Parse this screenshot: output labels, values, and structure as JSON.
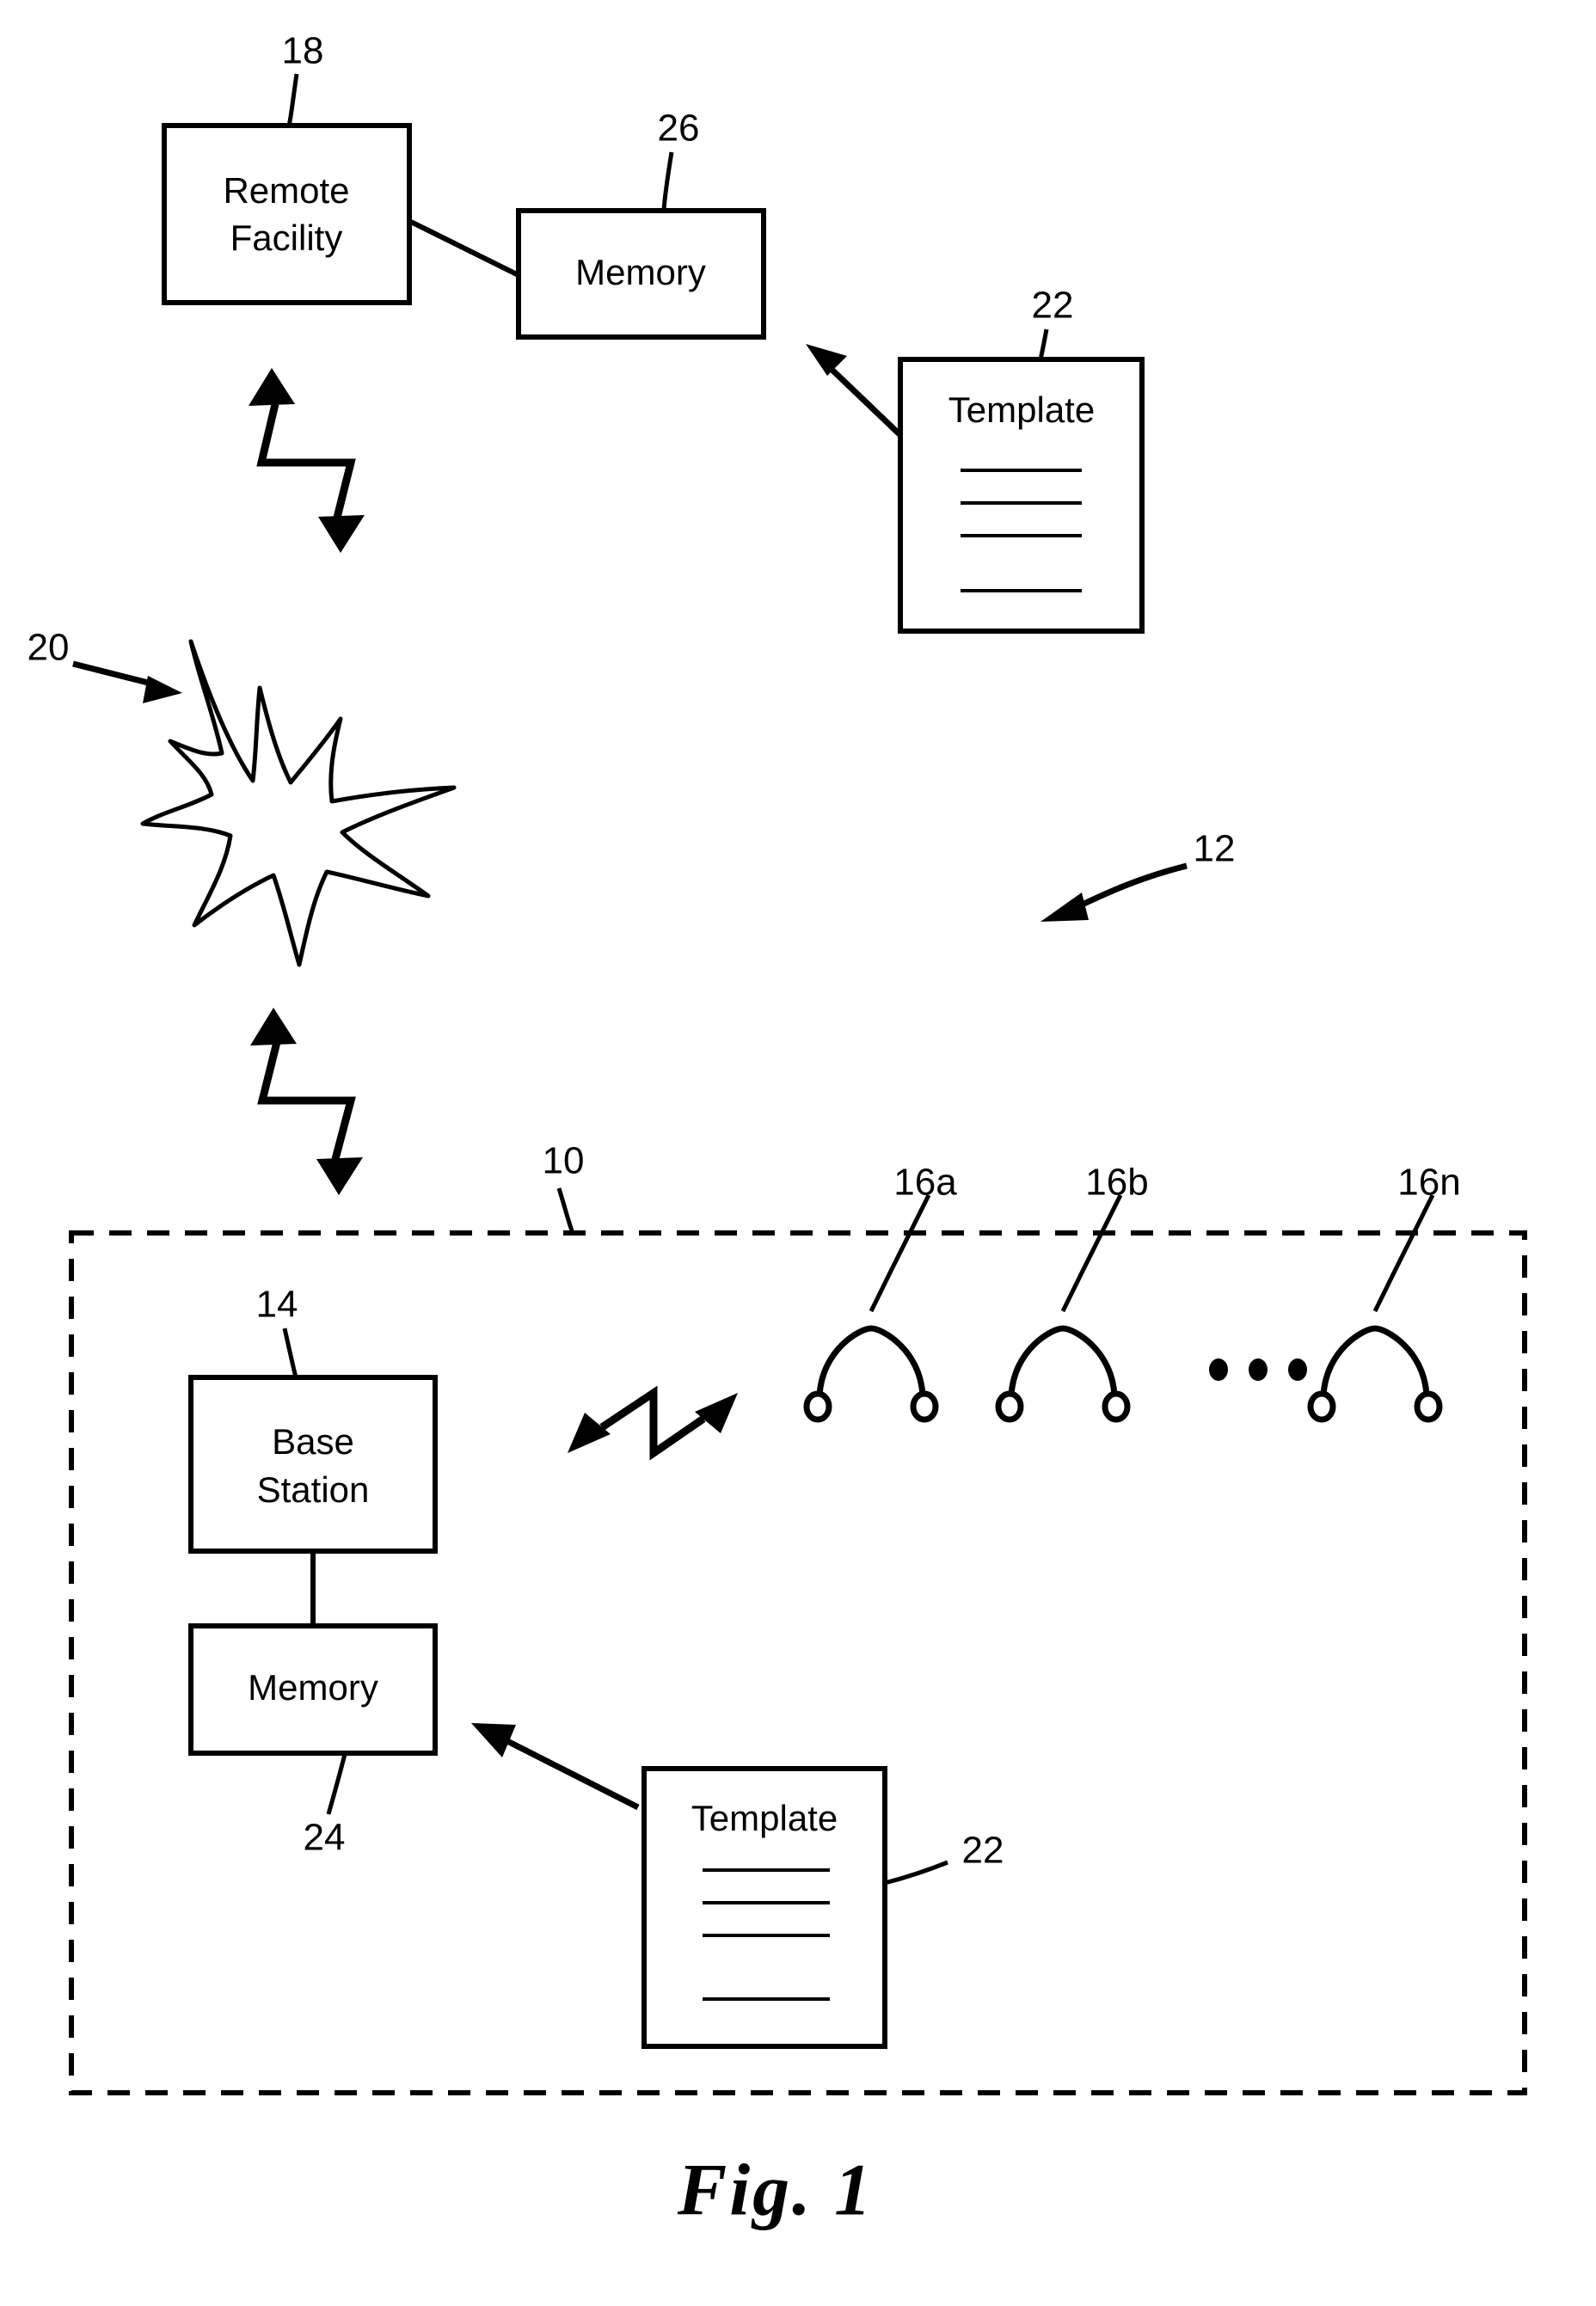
{
  "figure": {
    "caption": "Fig. 1",
    "system_ref": "12",
    "local_system_ref": "10"
  },
  "remote": {
    "facility": {
      "label_line1": "Remote",
      "label_line2": "Facility",
      "ref": "18"
    },
    "memory": {
      "label": "Memory",
      "ref": "26"
    },
    "template": {
      "title": "Template",
      "ref": "22",
      "rule_count": 4
    }
  },
  "network": {
    "ref": "20",
    "name": "wireless-network-cloud"
  },
  "local": {
    "ref": "10",
    "base_station": {
      "label_line1": "Base",
      "label_line2": "Station",
      "ref": "14"
    },
    "memory": {
      "label": "Memory",
      "ref": "24"
    },
    "template": {
      "title": "Template",
      "ref": "22",
      "rule_count": 4
    },
    "devices": [
      {
        "ref": "16a",
        "name": "stethoscope-icon"
      },
      {
        "ref": "16b",
        "name": "stethoscope-icon"
      },
      {
        "ref": "16n",
        "name": "stethoscope-icon"
      }
    ],
    "ellipsis": "•••"
  },
  "colors": {
    "ink": "#000000",
    "paper": "#ffffff"
  }
}
